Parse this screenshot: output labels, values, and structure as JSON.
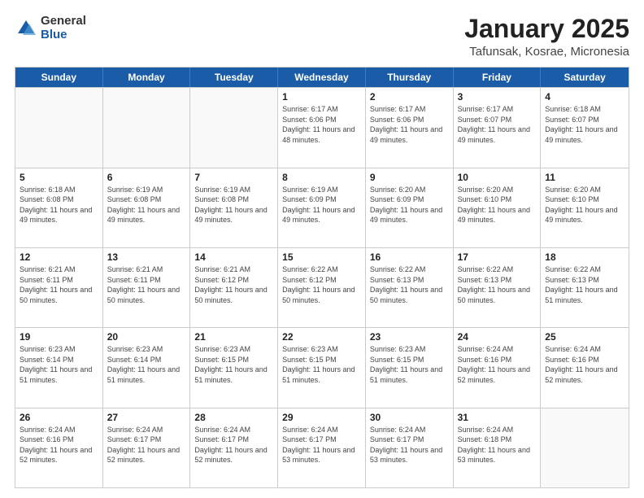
{
  "header": {
    "logo": {
      "general": "General",
      "blue": "Blue"
    },
    "title": "January 2025",
    "location": "Tafunsak, Kosrae, Micronesia"
  },
  "weekdays": [
    "Sunday",
    "Monday",
    "Tuesday",
    "Wednesday",
    "Thursday",
    "Friday",
    "Saturday"
  ],
  "weeks": [
    [
      {
        "day": "",
        "sunrise": "",
        "sunset": "",
        "daylight": ""
      },
      {
        "day": "",
        "sunrise": "",
        "sunset": "",
        "daylight": ""
      },
      {
        "day": "",
        "sunrise": "",
        "sunset": "",
        "daylight": ""
      },
      {
        "day": "1",
        "sunrise": "Sunrise: 6:17 AM",
        "sunset": "Sunset: 6:06 PM",
        "daylight": "Daylight: 11 hours and 48 minutes."
      },
      {
        "day": "2",
        "sunrise": "Sunrise: 6:17 AM",
        "sunset": "Sunset: 6:06 PM",
        "daylight": "Daylight: 11 hours and 49 minutes."
      },
      {
        "day": "3",
        "sunrise": "Sunrise: 6:17 AM",
        "sunset": "Sunset: 6:07 PM",
        "daylight": "Daylight: 11 hours and 49 minutes."
      },
      {
        "day": "4",
        "sunrise": "Sunrise: 6:18 AM",
        "sunset": "Sunset: 6:07 PM",
        "daylight": "Daylight: 11 hours and 49 minutes."
      }
    ],
    [
      {
        "day": "5",
        "sunrise": "Sunrise: 6:18 AM",
        "sunset": "Sunset: 6:08 PM",
        "daylight": "Daylight: 11 hours and 49 minutes."
      },
      {
        "day": "6",
        "sunrise": "Sunrise: 6:19 AM",
        "sunset": "Sunset: 6:08 PM",
        "daylight": "Daylight: 11 hours and 49 minutes."
      },
      {
        "day": "7",
        "sunrise": "Sunrise: 6:19 AM",
        "sunset": "Sunset: 6:08 PM",
        "daylight": "Daylight: 11 hours and 49 minutes."
      },
      {
        "day": "8",
        "sunrise": "Sunrise: 6:19 AM",
        "sunset": "Sunset: 6:09 PM",
        "daylight": "Daylight: 11 hours and 49 minutes."
      },
      {
        "day": "9",
        "sunrise": "Sunrise: 6:20 AM",
        "sunset": "Sunset: 6:09 PM",
        "daylight": "Daylight: 11 hours and 49 minutes."
      },
      {
        "day": "10",
        "sunrise": "Sunrise: 6:20 AM",
        "sunset": "Sunset: 6:10 PM",
        "daylight": "Daylight: 11 hours and 49 minutes."
      },
      {
        "day": "11",
        "sunrise": "Sunrise: 6:20 AM",
        "sunset": "Sunset: 6:10 PM",
        "daylight": "Daylight: 11 hours and 49 minutes."
      }
    ],
    [
      {
        "day": "12",
        "sunrise": "Sunrise: 6:21 AM",
        "sunset": "Sunset: 6:11 PM",
        "daylight": "Daylight: 11 hours and 50 minutes."
      },
      {
        "day": "13",
        "sunrise": "Sunrise: 6:21 AM",
        "sunset": "Sunset: 6:11 PM",
        "daylight": "Daylight: 11 hours and 50 minutes."
      },
      {
        "day": "14",
        "sunrise": "Sunrise: 6:21 AM",
        "sunset": "Sunset: 6:12 PM",
        "daylight": "Daylight: 11 hours and 50 minutes."
      },
      {
        "day": "15",
        "sunrise": "Sunrise: 6:22 AM",
        "sunset": "Sunset: 6:12 PM",
        "daylight": "Daylight: 11 hours and 50 minutes."
      },
      {
        "day": "16",
        "sunrise": "Sunrise: 6:22 AM",
        "sunset": "Sunset: 6:13 PM",
        "daylight": "Daylight: 11 hours and 50 minutes."
      },
      {
        "day": "17",
        "sunrise": "Sunrise: 6:22 AM",
        "sunset": "Sunset: 6:13 PM",
        "daylight": "Daylight: 11 hours and 50 minutes."
      },
      {
        "day": "18",
        "sunrise": "Sunrise: 6:22 AM",
        "sunset": "Sunset: 6:13 PM",
        "daylight": "Daylight: 11 hours and 51 minutes."
      }
    ],
    [
      {
        "day": "19",
        "sunrise": "Sunrise: 6:23 AM",
        "sunset": "Sunset: 6:14 PM",
        "daylight": "Daylight: 11 hours and 51 minutes."
      },
      {
        "day": "20",
        "sunrise": "Sunrise: 6:23 AM",
        "sunset": "Sunset: 6:14 PM",
        "daylight": "Daylight: 11 hours and 51 minutes."
      },
      {
        "day": "21",
        "sunrise": "Sunrise: 6:23 AM",
        "sunset": "Sunset: 6:15 PM",
        "daylight": "Daylight: 11 hours and 51 minutes."
      },
      {
        "day": "22",
        "sunrise": "Sunrise: 6:23 AM",
        "sunset": "Sunset: 6:15 PM",
        "daylight": "Daylight: 11 hours and 51 minutes."
      },
      {
        "day": "23",
        "sunrise": "Sunrise: 6:23 AM",
        "sunset": "Sunset: 6:15 PM",
        "daylight": "Daylight: 11 hours and 51 minutes."
      },
      {
        "day": "24",
        "sunrise": "Sunrise: 6:24 AM",
        "sunset": "Sunset: 6:16 PM",
        "daylight": "Daylight: 11 hours and 52 minutes."
      },
      {
        "day": "25",
        "sunrise": "Sunrise: 6:24 AM",
        "sunset": "Sunset: 6:16 PM",
        "daylight": "Daylight: 11 hours and 52 minutes."
      }
    ],
    [
      {
        "day": "26",
        "sunrise": "Sunrise: 6:24 AM",
        "sunset": "Sunset: 6:16 PM",
        "daylight": "Daylight: 11 hours and 52 minutes."
      },
      {
        "day": "27",
        "sunrise": "Sunrise: 6:24 AM",
        "sunset": "Sunset: 6:17 PM",
        "daylight": "Daylight: 11 hours and 52 minutes."
      },
      {
        "day": "28",
        "sunrise": "Sunrise: 6:24 AM",
        "sunset": "Sunset: 6:17 PM",
        "daylight": "Daylight: 11 hours and 52 minutes."
      },
      {
        "day": "29",
        "sunrise": "Sunrise: 6:24 AM",
        "sunset": "Sunset: 6:17 PM",
        "daylight": "Daylight: 11 hours and 53 minutes."
      },
      {
        "day": "30",
        "sunrise": "Sunrise: 6:24 AM",
        "sunset": "Sunset: 6:17 PM",
        "daylight": "Daylight: 11 hours and 53 minutes."
      },
      {
        "day": "31",
        "sunrise": "Sunrise: 6:24 AM",
        "sunset": "Sunset: 6:18 PM",
        "daylight": "Daylight: 11 hours and 53 minutes."
      },
      {
        "day": "",
        "sunrise": "",
        "sunset": "",
        "daylight": ""
      }
    ]
  ]
}
